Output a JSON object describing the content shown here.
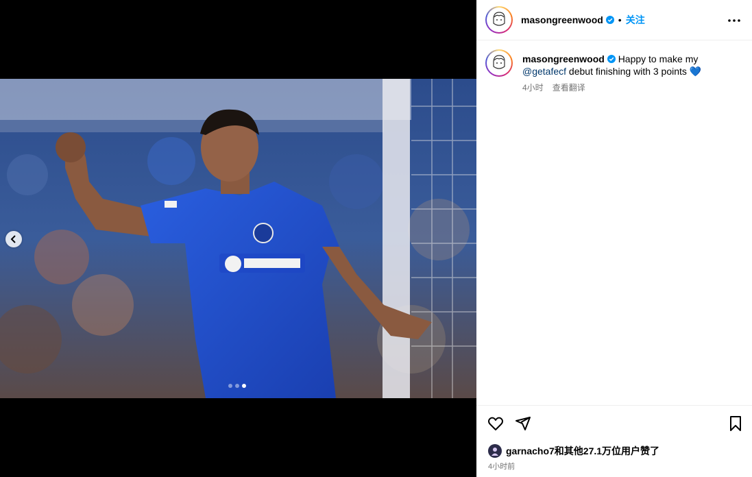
{
  "post": {
    "username": "masongreenwood",
    "follow_label": "关注",
    "separator": "•",
    "caption_text": "Happy to make my",
    "caption_mention": "@getafecf",
    "caption_text2": " debut finishing with 3 points",
    "caption_emoji": "💙",
    "caption_time": "4小时",
    "see_translation": "查看翻译",
    "likes_text": "garnacho7和其他27.1万位用户赞了",
    "time_ago": "4小时前"
  },
  "carousel": {
    "slide_count": 3,
    "active_slide": 3
  },
  "icons": {
    "verified": "verified-badge-icon",
    "more": "more-options-icon",
    "like": "heart-icon",
    "share": "share-icon",
    "save": "bookmark-icon",
    "prev": "chevron-left-icon"
  },
  "colors": {
    "accent": "#0095f6",
    "mention": "#00376b",
    "muted": "#737373",
    "kit_blue": "#1e4fd6"
  }
}
